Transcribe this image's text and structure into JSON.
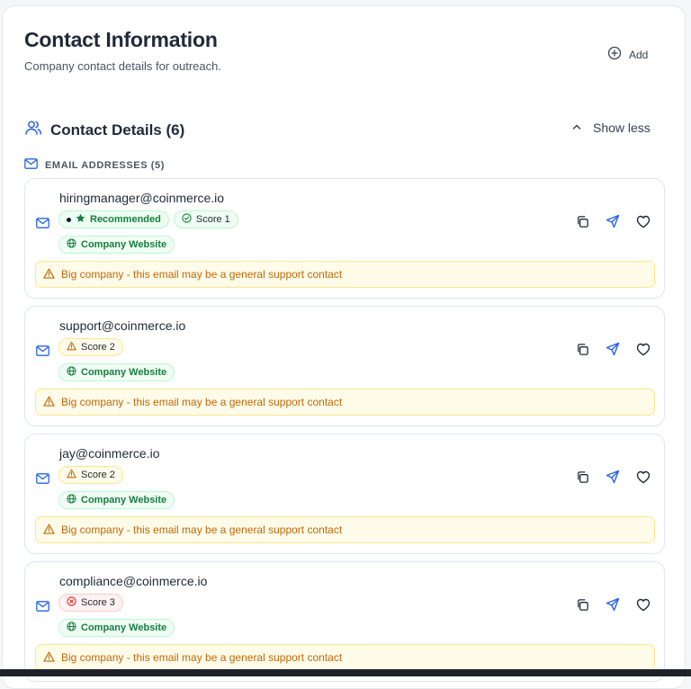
{
  "header": {
    "title": "Contact Information",
    "subtitle": "Company contact details for outreach.",
    "add_label": "Add"
  },
  "contact_details": {
    "title": "Contact Details (6)",
    "toggle_label": "Show less",
    "emails_label": "EMAIL ADDRESSES (5)"
  },
  "emails": [
    {
      "address": "hiringmanager@coinmerce.io",
      "recommended": "Recommended",
      "score": "Score 1",
      "score_level": "good",
      "source": "Company Website",
      "warning": "Big company - this email may be a general support contact"
    },
    {
      "address": "support@coinmerce.io",
      "score": "Score 2",
      "score_level": "warn",
      "source": "Company Website",
      "warning": "Big company - this email may be a general support contact"
    },
    {
      "address": "jay@coinmerce.io",
      "score": "Score 2",
      "score_level": "warn",
      "source": "Company Website",
      "warning": "Big company - this email may be a general support contact"
    },
    {
      "address": "compliance@coinmerce.io",
      "score": "Score 3",
      "score_level": "bad",
      "source": "Company Website",
      "warning": "Big company - this email may be a general support contact"
    }
  ],
  "colors": {
    "accent_blue": "#2563eb",
    "success_green": "#15803d",
    "warning_amber": "#c2680b",
    "danger_red": "#dc2626"
  }
}
